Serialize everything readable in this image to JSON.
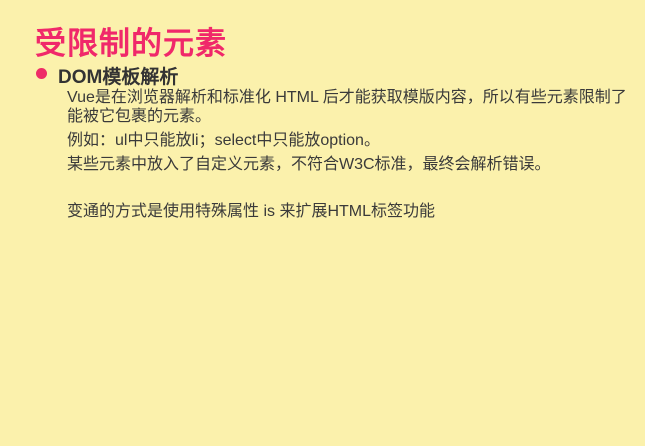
{
  "slide": {
    "title": "受限制的元素",
    "heading": "DOM模板解析",
    "paragraphs": [
      "Vue是在浏览器解析和标准化 HTML 后才能获取模版内容，所以有些元素限制了能被它包裹的元素。",
      "例如：ul中只能放li；select中只能放option。",
      "某些元素中放入了自定义元素，不符合W3C标准，最终会解析错误。",
      "变通的方式是使用特殊属性 is 来扩展HTML标签功能"
    ],
    "colors": {
      "background": "#fbf1ac",
      "title": "#f0286a",
      "bullet": "#ee2c67"
    }
  }
}
